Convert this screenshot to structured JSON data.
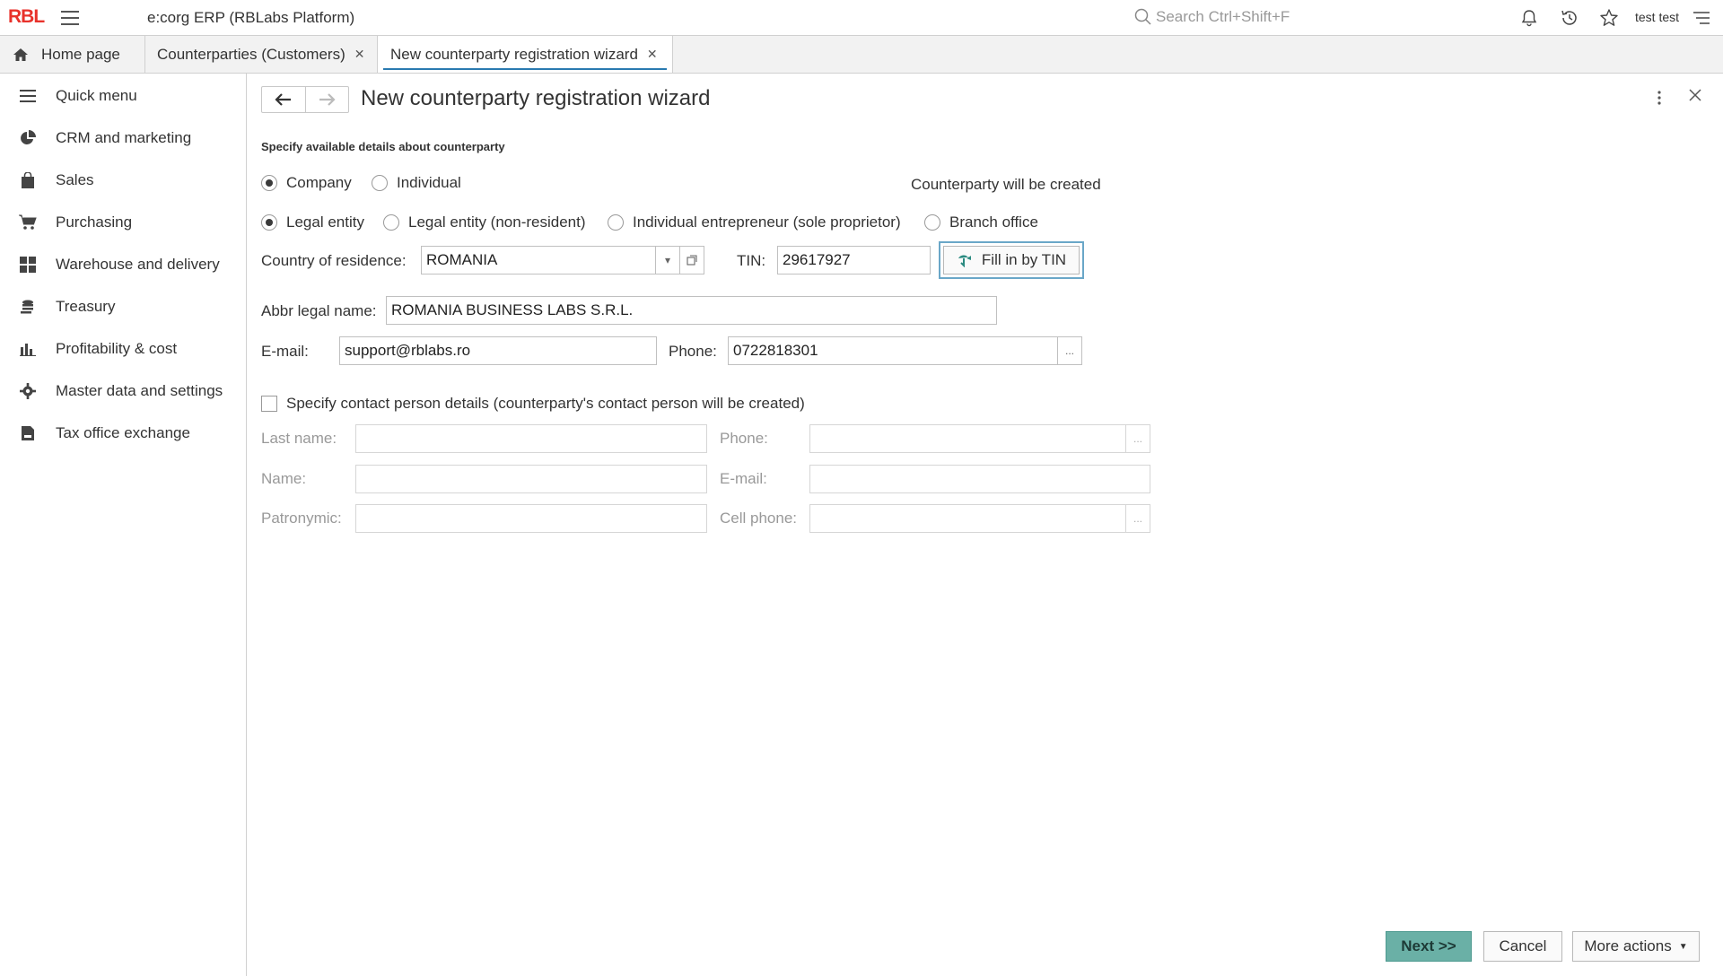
{
  "app": {
    "logo": "RBL",
    "title": "e:corg ERP  (RBLabs Platform)",
    "search_placeholder": "Search Ctrl+Shift+F",
    "user": "test test"
  },
  "tabs": [
    {
      "label": "Home page",
      "icon": "home-icon"
    },
    {
      "label": "Counterparties (Customers)",
      "closable": true
    },
    {
      "label": "New counterparty registration wizard",
      "closable": true,
      "active": true
    }
  ],
  "sidebar": {
    "items": [
      {
        "label": "Quick menu",
        "icon": "menu-list-icon"
      },
      {
        "label": "CRM and marketing",
        "icon": "pie-chart-icon"
      },
      {
        "label": "Sales",
        "icon": "shopping-bag-icon"
      },
      {
        "label": "Purchasing",
        "icon": "cart-icon"
      },
      {
        "label": "Warehouse and delivery",
        "icon": "grid-icon"
      },
      {
        "label": "Treasury",
        "icon": "coins-icon"
      },
      {
        "label": "Profitability & cost",
        "icon": "bar-chart-icon"
      },
      {
        "label": "Master data and settings",
        "icon": "gear-icon"
      },
      {
        "label": "Tax office exchange",
        "icon": "tax-document-icon"
      }
    ]
  },
  "form": {
    "title": "New counterparty registration wizard",
    "subheading": "Specify available details about counterparty",
    "type_options": [
      {
        "label": "Company",
        "selected": true
      },
      {
        "label": "Individual",
        "selected": false
      }
    ],
    "status_text": "Counterparty will be created",
    "entity_options": [
      {
        "label": "Legal entity",
        "selected": true
      },
      {
        "label": "Legal entity (non-resident)",
        "selected": false
      },
      {
        "label": "Individual entrepreneur (sole proprietor)",
        "selected": false
      },
      {
        "label": "Branch office",
        "selected": false
      }
    ],
    "country_label": "Country of residence:",
    "country_value": "ROMANIA",
    "tin_label": "TIN:",
    "tin_value": "29617927",
    "fill_button": "Fill in by TIN",
    "abbr_label": "Abbr legal name:",
    "abbr_value": "ROMANIA BUSINESS LABS S.R.L.",
    "email_label": "E-mail:",
    "email_value": "support@rblabs.ro",
    "phone_label": "Phone:",
    "phone_value": "0722818301",
    "ellipsis": "...",
    "contact_checkbox": "Specify contact person details (counterparty's contact person will be created)",
    "contact": {
      "last_name_label": "Last name:",
      "name_label": "Name:",
      "patronymic_label": "Patronymic:",
      "phone_label": "Phone:",
      "email_label": "E-mail:",
      "cell_label": "Cell phone:"
    }
  },
  "footer": {
    "next": "Next >>",
    "cancel": "Cancel",
    "more": "More actions"
  },
  "colors": {
    "logo": "#e8322b",
    "primary_button": "#6ab0a6",
    "focus_border": "#6aa7c8",
    "active_tab_underline": "#2a7ab0"
  }
}
